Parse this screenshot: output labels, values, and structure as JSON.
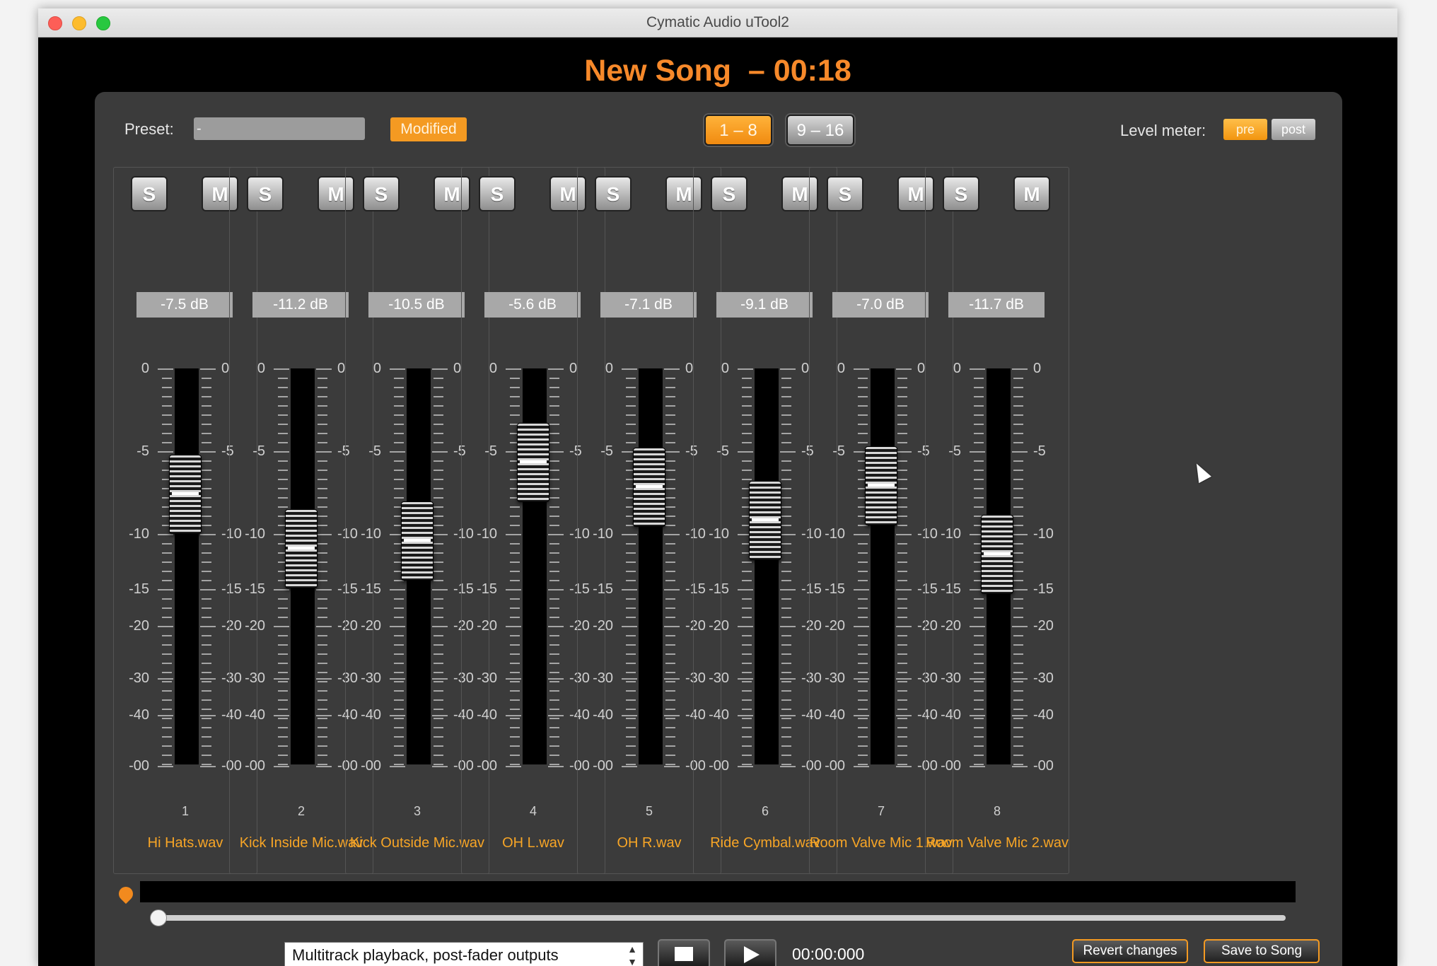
{
  "window": {
    "title": "Cymatic Audio uTool2"
  },
  "song": {
    "title": "New Song  – 00:18"
  },
  "preset": {
    "label": "Preset:",
    "value": "-",
    "status": "Modified"
  },
  "banks": {
    "active": "1 – 8",
    "inactive": "9 – 16"
  },
  "level_meter": {
    "label": "Level meter:",
    "pre": "pre",
    "post": "post"
  },
  "scale": {
    "marks": [
      "0",
      "-5",
      "-10",
      "-15",
      "-20",
      "-30",
      "-40",
      "-00"
    ]
  },
  "channels": [
    {
      "solo": "S",
      "mute": "M",
      "gain": "-7.5 dB",
      "gain_value": -7.5,
      "number": "1",
      "name": "Hi Hats.wav"
    },
    {
      "solo": "S",
      "mute": "M",
      "gain": "-11.2 dB",
      "gain_value": -11.2,
      "number": "2",
      "name": "Kick Inside Mic.wav"
    },
    {
      "solo": "S",
      "mute": "M",
      "gain": "-10.5 dB",
      "gain_value": -10.5,
      "number": "3",
      "name": "Kick Outside Mic.wav"
    },
    {
      "solo": "S",
      "mute": "M",
      "gain": "-5.6 dB",
      "gain_value": -5.6,
      "number": "4",
      "name": "OH L.wav"
    },
    {
      "solo": "S",
      "mute": "M",
      "gain": "-7.1 dB",
      "gain_value": -7.1,
      "number": "5",
      "name": "OH R.wav"
    },
    {
      "solo": "S",
      "mute": "M",
      "gain": "-9.1 dB",
      "gain_value": -9.1,
      "number": "6",
      "name": "Ride Cymbal.wav"
    },
    {
      "solo": "S",
      "mute": "M",
      "gain": "-7.0 dB",
      "gain_value": -7.0,
      "number": "7",
      "name": "Room Valve Mic 1.wav"
    },
    {
      "solo": "S",
      "mute": "M",
      "gain": "-11.7 dB",
      "gain_value": -11.7,
      "number": "8",
      "name": "Room Valve Mic 2.wav"
    }
  ],
  "transport": {
    "mode": "Multitrack playback, post-fader outputs",
    "time": "00:00:000",
    "revert_label": "Revert changes",
    "save_label": "Save to Song"
  },
  "colors": {
    "accent": "#f7892a",
    "channel_name": "#f7a526"
  }
}
